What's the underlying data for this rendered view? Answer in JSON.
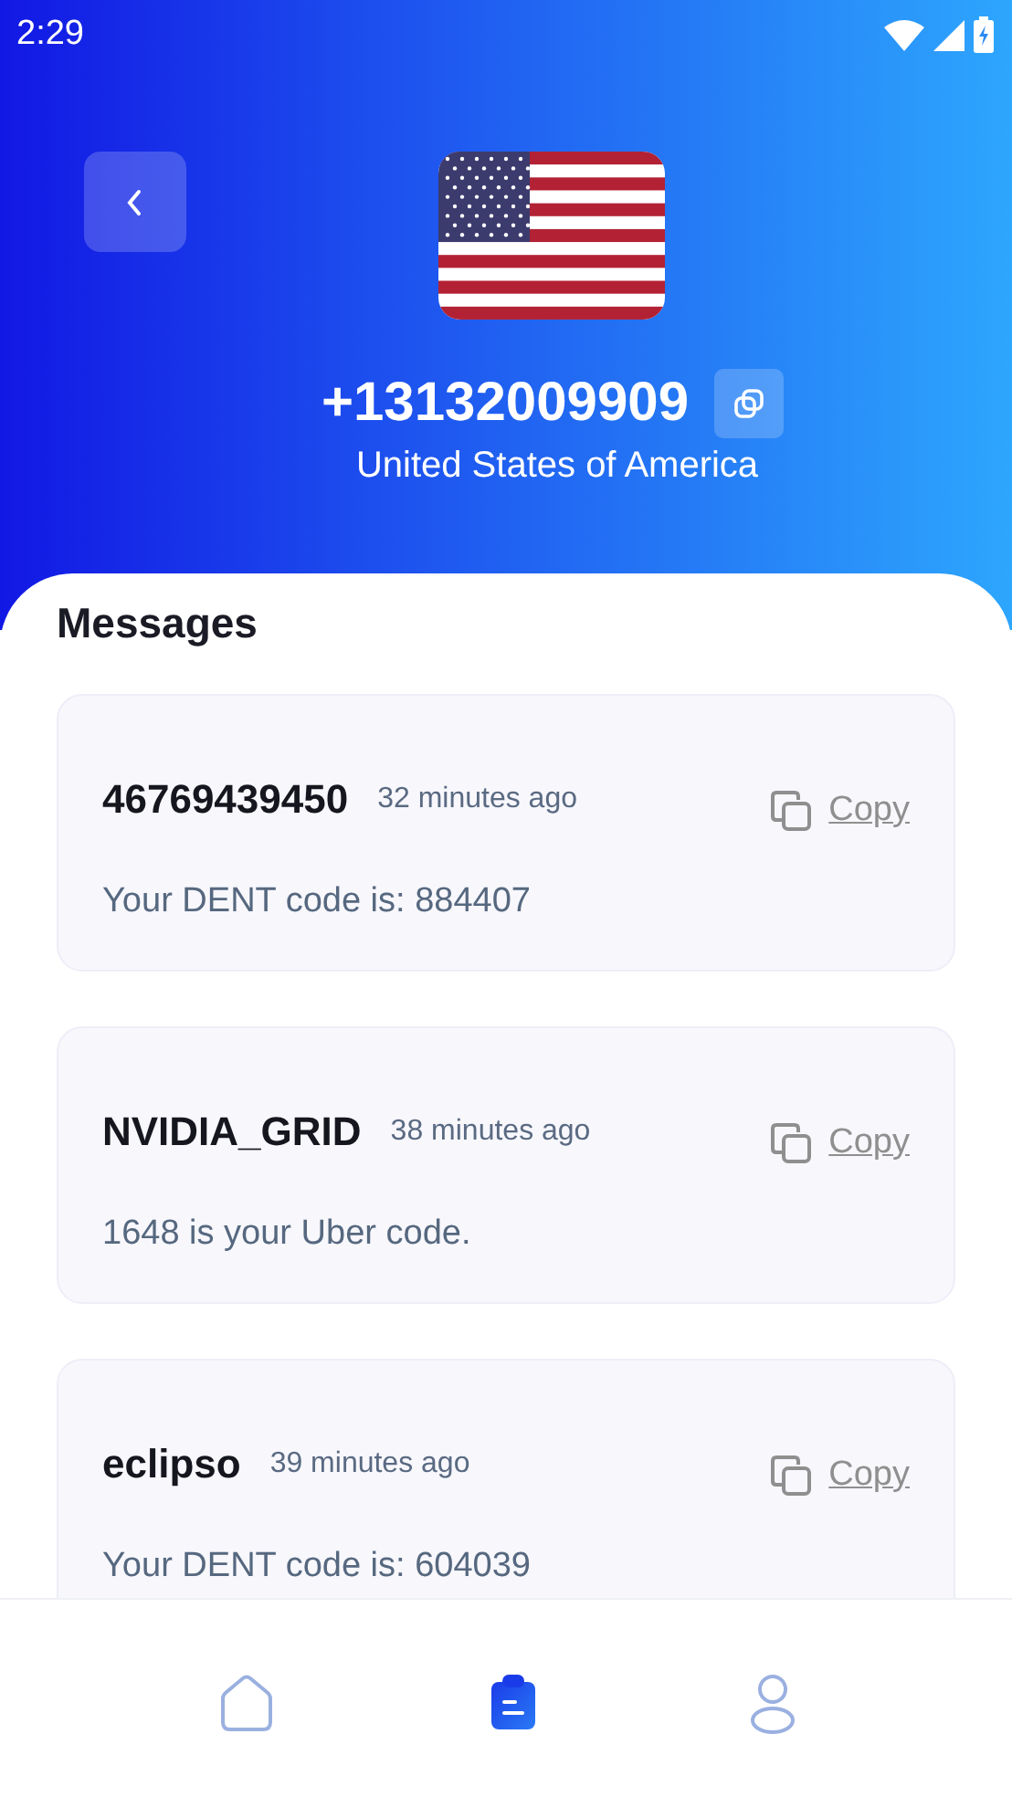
{
  "status_bar": {
    "time": "2:29"
  },
  "header": {
    "phone_number": "+13132009909",
    "country": "United States of America"
  },
  "messages_title": "Messages",
  "messages": [
    {
      "sender": "46769439450",
      "time": "32 minutes ago",
      "copy_label": "Copy",
      "text": "Your DENT code is: 884407"
    },
    {
      "sender": "NVIDIA_GRID",
      "time": "38 minutes ago",
      "copy_label": "Copy",
      "text": "1648 is your Uber code."
    },
    {
      "sender": "eclipso",
      "time": "39 minutes ago",
      "copy_label": "Copy",
      "text": "Your DENT code is: 604039"
    }
  ],
  "nav": [
    {
      "kind": "home",
      "selected": false
    },
    {
      "kind": "messages",
      "selected": true
    },
    {
      "kind": "profile",
      "selected": false
    }
  ]
}
